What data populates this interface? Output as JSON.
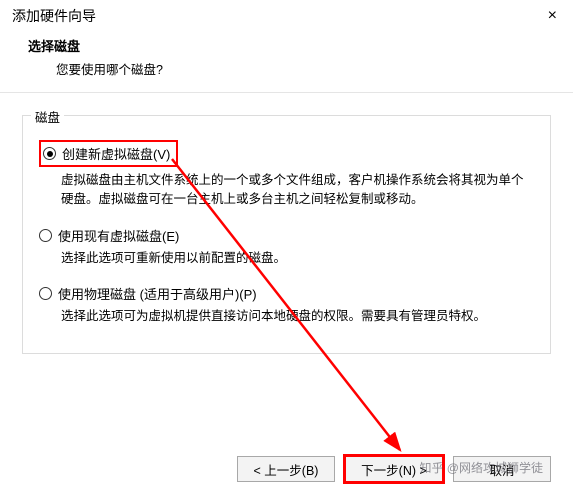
{
  "titlebar": {
    "title": "添加硬件向导"
  },
  "header": {
    "subtitle": "选择磁盘",
    "question": "您要使用哪个磁盘?"
  },
  "group_legend": "磁盘",
  "options": [
    {
      "label": "创建新虚拟磁盘(V)",
      "desc": "虚拟磁盘由主机文件系统上的一个或多个文件组成，客户机操作系统会将其视为单个硬盘。虚拟磁盘可在一台主机上或多台主机之间轻松复制或移动。"
    },
    {
      "label": "使用现有虚拟磁盘(E)",
      "desc": "选择此选项可重新使用以前配置的磁盘。"
    },
    {
      "label": "使用物理磁盘 (适用于高级用户)(P)",
      "desc": "选择此选项可为虚拟机提供直接访问本地硬盘的权限。需要具有管理员特权。"
    }
  ],
  "buttons": {
    "back": "< 上一步(B)",
    "next": "下一步(N) >",
    "cancel": "取消"
  },
  "watermark": "知乎 @网络攻城狮学徒"
}
